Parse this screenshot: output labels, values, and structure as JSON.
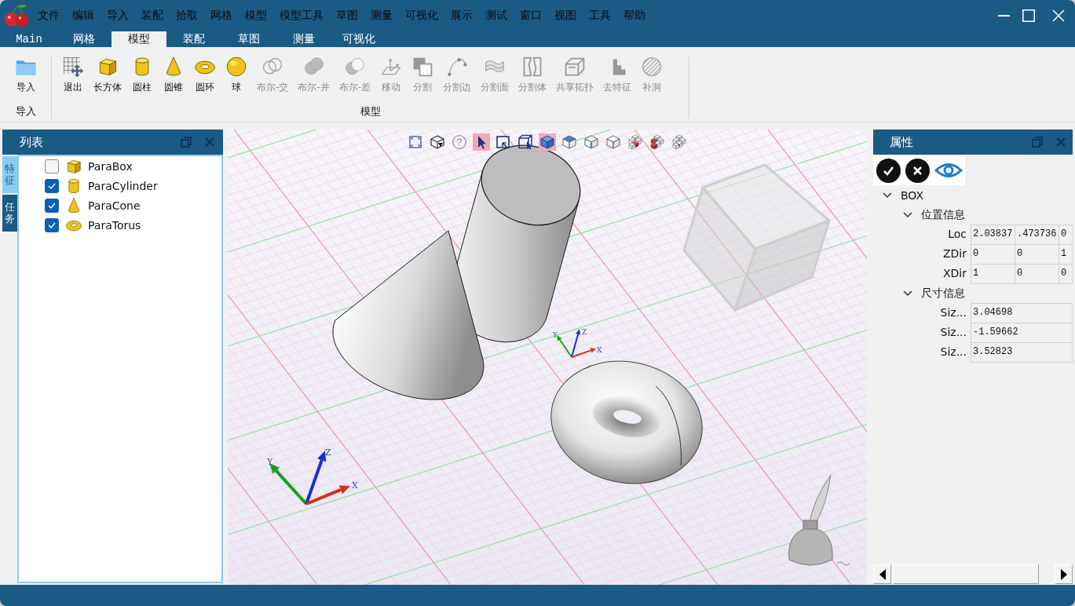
{
  "menu": {
    "items": [
      "文件",
      "编辑",
      "导入",
      "装配",
      "拾取",
      "网格",
      "模型",
      "模型工具",
      "草图",
      "测量",
      "可视化",
      "展示",
      "测试",
      "窗口",
      "视图",
      "工具",
      "帮助"
    ]
  },
  "tabs": [
    {
      "label": "Main",
      "selected": false
    },
    {
      "label": "网格",
      "selected": false
    },
    {
      "label": "模型",
      "selected": true
    },
    {
      "label": "装配",
      "selected": false
    },
    {
      "label": "草图",
      "selected": false
    },
    {
      "label": "测量",
      "selected": false
    },
    {
      "label": "可视化",
      "selected": false
    }
  ],
  "ribbon": {
    "groups": [
      {
        "label": "导入",
        "buttons": [
          {
            "kind": "folder",
            "label": "导入",
            "disabled": false
          }
        ]
      },
      {
        "label": "模型",
        "buttons": [
          {
            "kind": "grid-move",
            "label": "退出",
            "disabled": false
          },
          {
            "kind": "box",
            "label": "长方体",
            "disabled": false
          },
          {
            "kind": "cylinder",
            "label": "圆柱",
            "disabled": false
          },
          {
            "kind": "cone",
            "label": "圆锥",
            "disabled": false
          },
          {
            "kind": "torus",
            "label": "圆环",
            "disabled": false
          },
          {
            "kind": "sphere",
            "label": "球",
            "disabled": false
          },
          {
            "kind": "intersect",
            "label": "布尔-交",
            "disabled": true
          },
          {
            "kind": "union",
            "label": "布尔-并",
            "disabled": true
          },
          {
            "kind": "difference",
            "label": "布尔-差",
            "disabled": true
          },
          {
            "kind": "move",
            "label": "移动",
            "disabled": true
          },
          {
            "kind": "split",
            "label": "分割",
            "disabled": true
          },
          {
            "kind": "split-edge",
            "label": "分割边",
            "disabled": true
          },
          {
            "kind": "split-face",
            "label": "分割面",
            "disabled": true
          },
          {
            "kind": "split-body",
            "label": "分割体",
            "disabled": true
          },
          {
            "kind": "shared-topology",
            "label": "共享拓扑",
            "disabled": true
          },
          {
            "kind": "defeature",
            "label": "去特征",
            "disabled": true
          },
          {
            "kind": "fill-hole",
            "label": "补洞",
            "disabled": true
          }
        ]
      }
    ]
  },
  "left_panel": {
    "title": "列表",
    "side_tabs": [
      {
        "label": "特征",
        "selected": true
      },
      {
        "label": "任务",
        "selected": false
      }
    ],
    "items": [
      {
        "kind": "box",
        "label": "ParaBox",
        "checked": false
      },
      {
        "kind": "cylinder",
        "label": "ParaCylinder",
        "checked": true
      },
      {
        "kind": "cone",
        "label": "ParaCone",
        "checked": true
      },
      {
        "kind": "torus",
        "label": "ParaTorus",
        "checked": true
      }
    ]
  },
  "viewport": {
    "tools": [
      {
        "kind": "fit",
        "selected": false
      },
      {
        "kind": "orient",
        "selected": false
      },
      {
        "kind": "help",
        "selected": false
      },
      {
        "kind": "pointer",
        "selected": true
      },
      {
        "kind": "zoom-window",
        "selected": false
      },
      {
        "kind": "box-zoom",
        "selected": false
      },
      {
        "kind": "shaded",
        "selected": true
      },
      {
        "kind": "top",
        "selected": false
      },
      {
        "kind": "front",
        "selected": false
      },
      {
        "kind": "corner",
        "selected": false
      },
      {
        "kind": "cubes-a",
        "selected": false
      },
      {
        "kind": "cubes-b",
        "selected": false
      },
      {
        "kind": "cubes-c",
        "selected": false
      }
    ],
    "triads": [
      {
        "x": "X",
        "y": "Y",
        "z": "Z"
      },
      {
        "x": "X",
        "y": "Y",
        "z": "Z"
      }
    ]
  },
  "right_panel": {
    "title": "属性",
    "tree": [
      {
        "label": "BOX",
        "expanded": true,
        "children": [
          {
            "label": "位置信息",
            "expanded": true,
            "children": [
              {
                "label": "Loc",
                "values": [
                  "2.03837",
                  ".473736",
                  "0"
                ]
              },
              {
                "label": "ZDir",
                "values": [
                  "0",
                  "0",
                  "1"
                ]
              },
              {
                "label": "XDir",
                "values": [
                  "1",
                  "0",
                  "0"
                ]
              }
            ]
          },
          {
            "label": "尺寸信息",
            "expanded": true,
            "children": [
              {
                "label": "Siz...",
                "values": [
                  "3.04698"
                ]
              },
              {
                "label": "Siz...",
                "values": [
                  "-1.59662"
                ]
              },
              {
                "label": "Siz...",
                "values": [
                  "3.52823"
                ]
              }
            ]
          }
        ]
      }
    ]
  }
}
